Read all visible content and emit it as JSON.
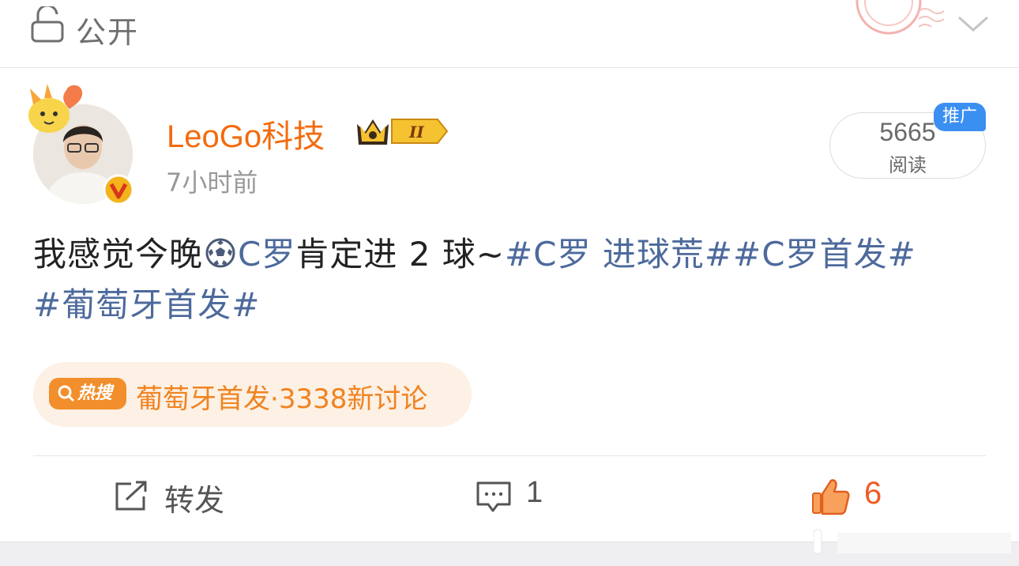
{
  "visibility": {
    "label": "公开",
    "icon": "lock-icon"
  },
  "author": {
    "name": "LeoGo科技",
    "level": "II",
    "time": "7小时前",
    "verified_icon": "verified-v-icon"
  },
  "reads": {
    "count": "5665",
    "label": "阅读",
    "badge": "推广"
  },
  "post": {
    "text_plain": "我感觉今晚",
    "text_after_icon": "C罗肯定进2球~",
    "topics": [
      "#C罗 进球荒#",
      "#C罗首发#",
      "#葡萄牙首发#"
    ]
  },
  "hot_search": {
    "badge": "热搜",
    "topic": "葡萄牙首发",
    "separator": "·",
    "count_text": "3338新讨论"
  },
  "actions": {
    "share_label": "转发",
    "comment_count": "1",
    "like_count": "6"
  },
  "colors": {
    "username": "#f36b0d",
    "topic": "#4d6a9c",
    "hot": "#f08320",
    "like": "#f05a24",
    "promo": "#3b8ff0"
  }
}
